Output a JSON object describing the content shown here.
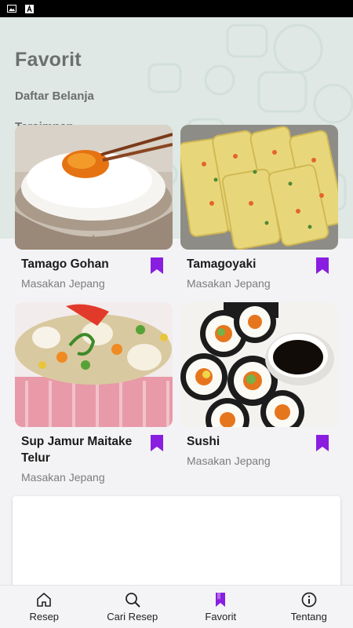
{
  "status_bar": {
    "icons": [
      "image-icon",
      "a-icon"
    ]
  },
  "header": {
    "title": "Favorit",
    "links": [
      "Daftar Belanja",
      "Tersimpan"
    ]
  },
  "recipes": [
    {
      "title": "Tamago Gohan",
      "category": "Masakan Jepang",
      "image": "tamago-gohan"
    },
    {
      "title": "Tamagoyaki",
      "category": "Masakan Jepang",
      "image": "tamagoyaki"
    },
    {
      "title": "Sup Jamur Maitake Telur",
      "category": "Masakan Jepang",
      "image": "sup-jamur"
    },
    {
      "title": "Sushi",
      "category": "Masakan Jepang",
      "image": "sushi"
    }
  ],
  "bottom_nav": [
    {
      "label": "Resep",
      "icon": "home-icon",
      "active": false
    },
    {
      "label": "Cari Resep",
      "icon": "search-icon",
      "active": false
    },
    {
      "label": "Favorit",
      "icon": "bookmark-icon",
      "active": true
    },
    {
      "label": "Tentang",
      "icon": "info-icon",
      "active": false
    }
  ],
  "colors": {
    "accent": "#8a1ee0",
    "header_bg": "#dfe8e4",
    "page_bg": "#f3f3f5"
  }
}
